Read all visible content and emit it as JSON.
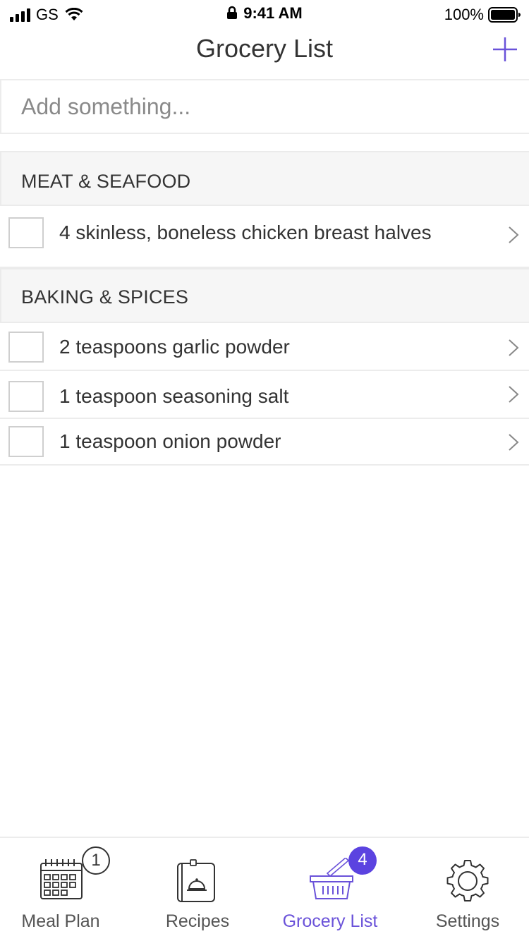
{
  "status_bar": {
    "carrier": "GS",
    "time": "9:41 AM",
    "battery": "100%"
  },
  "nav": {
    "title": "Grocery List",
    "add_icon": "plus-icon"
  },
  "add_input": {
    "placeholder": "Add something...",
    "value": ""
  },
  "sections": [
    {
      "title": "MEAT & SEAFOOD",
      "items": [
        {
          "text": "4 skinless, boneless chicken breast halves",
          "checked": false
        }
      ]
    },
    {
      "title": "BAKING & SPICES",
      "items": [
        {
          "text": "2 teaspoons garlic powder",
          "checked": false
        },
        {
          "text": "1 teaspoon seasoning salt",
          "checked": false
        },
        {
          "text": "1 teaspoon onion powder",
          "checked": false
        }
      ]
    }
  ],
  "tabs": [
    {
      "label": "Meal Plan",
      "icon": "calendar-icon",
      "badge": "1",
      "active": false
    },
    {
      "label": "Recipes",
      "icon": "recipe-book-icon",
      "badge": "",
      "active": false
    },
    {
      "label": "Grocery List",
      "icon": "basket-icon",
      "badge": "4",
      "active": true
    },
    {
      "label": "Settings",
      "icon": "gear-icon",
      "badge": "",
      "active": false
    }
  ],
  "colors": {
    "accent": "#6a52d9",
    "badge": "#5b43e0",
    "divider": "#ececec",
    "section_bg": "#f6f6f6"
  }
}
